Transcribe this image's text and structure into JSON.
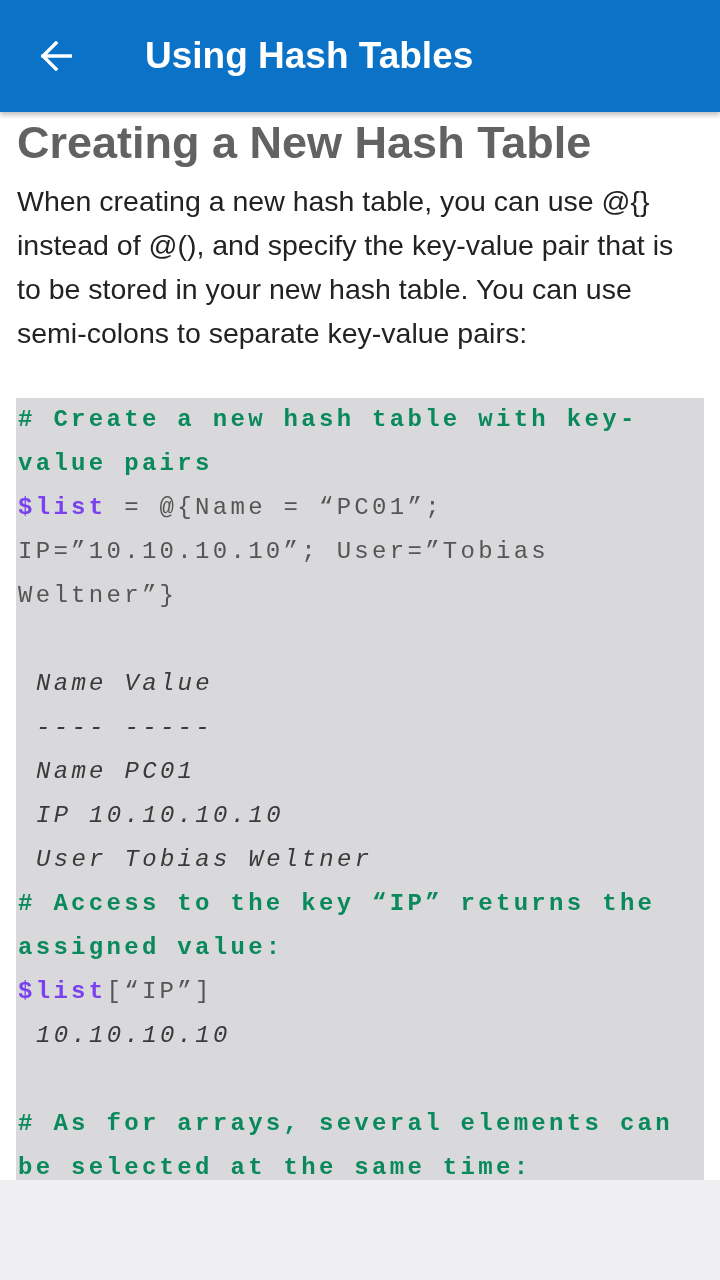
{
  "app_bar": {
    "title": "Using Hash Tables"
  },
  "article": {
    "heading": "Creating a New Hash Table",
    "paragraph": "When creating a new hash table, you can use @{} instead of @(), and specify the key-value pair that is to be stored in your new hash table. You can use semi-colons to separate key-value pairs:",
    "code_lines": [
      {
        "kind": "comment",
        "text": "# Create a new hash table with key-value pairs"
      },
      {
        "kind": "code",
        "text": "**$list** = @{Name = “PC01”; IP=”10.10.10.10”; User=”Tobias Weltner”}"
      },
      {
        "kind": "blank"
      },
      {
        "kind": "output",
        "text": "Name Value"
      },
      {
        "kind": "output",
        "text": "---- -----"
      },
      {
        "kind": "output",
        "text": "Name PC01"
      },
      {
        "kind": "output",
        "text": "IP 10.10.10.10"
      },
      {
        "kind": "output",
        "text": "User Tobias Weltner"
      },
      {
        "kind": "comment",
        "text": "# Access to the key “IP” returns the assigned value:"
      },
      {
        "kind": "code",
        "text": "**$list**[“IP”]"
      },
      {
        "kind": "output",
        "text": "10.10.10.10"
      },
      {
        "kind": "blank"
      },
      {
        "kind": "comment",
        "text": "# As for arrays, several elements can be selected at the same time:"
      }
    ]
  }
}
